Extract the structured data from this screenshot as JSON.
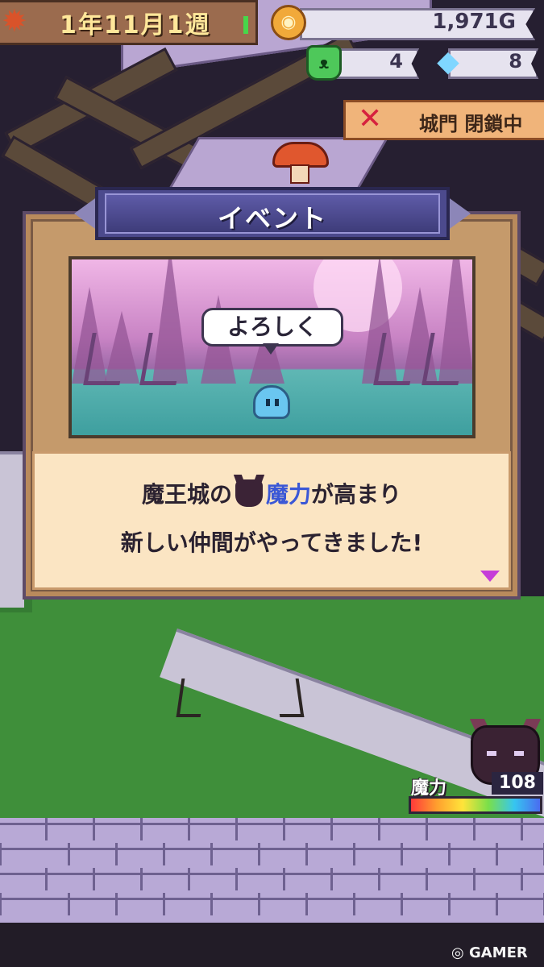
{
  "hud": {
    "date": "1年11月1週",
    "gold": "1,971G",
    "monster_count": "4",
    "crystal_count": "8",
    "gate_status": "城門 閉鎖中"
  },
  "event_dialog": {
    "title": "イベント",
    "speech_bubble": "よろしく",
    "message": {
      "line1_before": "魔王城の",
      "line1_highlight": "魔力",
      "line1_after": "が高まり",
      "line2": "新しい仲間がやってきました!"
    }
  },
  "mana": {
    "label": "魔力",
    "value": "108",
    "fill_fraction": 1.0
  },
  "watermark": "GAMER",
  "icons": {
    "leaf": "maple-leaf-icon",
    "coin": "gold-coin-icon",
    "monster": "green-demon-icon",
    "crystal": "crystal-icon",
    "gate": "crossed-swords-icon",
    "demon_king": "demon-king-icon",
    "next": "next-arrow-icon"
  },
  "colors": {
    "highlight_text": "#3a57d6",
    "gate_x": "#d6213e",
    "next_arrow": "#c63dd8"
  }
}
